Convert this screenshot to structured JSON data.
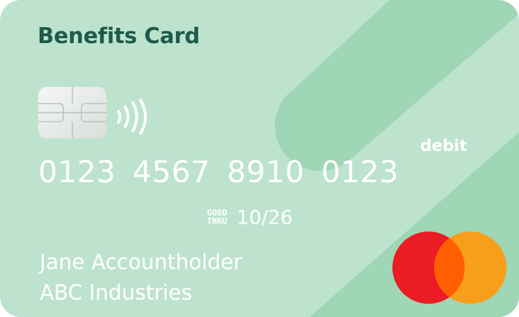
{
  "card": {
    "title": "Benefits Card",
    "type_label": "debit",
    "number": "0123 4567 8910 0123",
    "good_thru": {
      "line1": "GOOD",
      "line2": "THRU"
    },
    "expiry": "10/26",
    "holder_name": "Jane Accountholder",
    "company": "ABC Industries"
  },
  "icons": {
    "chip": "emv-chip-icon",
    "contactless": "contactless-icon",
    "brand": "mastercard-logo"
  },
  "colors": {
    "card_background": "#bde3cf",
    "stripe": "#9fd6b5",
    "title_text": "#1f5a4a",
    "text": "#ffffff",
    "logo_red": "#eb1c23",
    "logo_orange": "#f79e1b",
    "logo_overlap": "#ff5f00"
  }
}
